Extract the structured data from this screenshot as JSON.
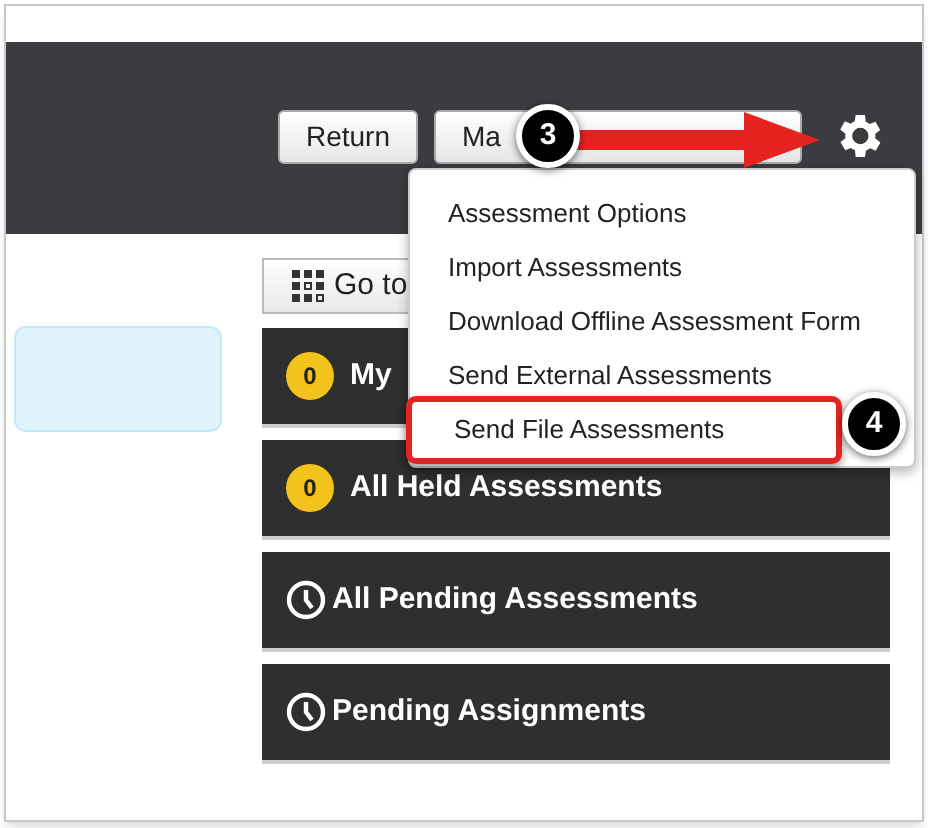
{
  "header": {
    "buttons": [
      {
        "label": "Return"
      },
      {
        "label": "Ma"
      }
    ]
  },
  "callouts": [
    {
      "label": "3"
    },
    {
      "label": "4"
    }
  ],
  "menu": {
    "items": [
      {
        "label": "Assessment Options",
        "selected": false
      },
      {
        "label": "Import Assessments",
        "selected": false
      },
      {
        "label": "Download Offline Assessment Form",
        "selected": false
      },
      {
        "label": "Send External Assessments",
        "selected": false
      },
      {
        "label": "Send File Assessments",
        "selected": true
      }
    ]
  },
  "goto_button": {
    "label": "Go to"
  },
  "tiles": [
    {
      "kind": "count",
      "badge": "0",
      "label": "My"
    },
    {
      "kind": "count",
      "badge": "0",
      "label": "All Held Assessments"
    },
    {
      "kind": "pending",
      "label": "All Pending Assessments"
    },
    {
      "kind": "pending",
      "label": "Pending Assignments"
    }
  ]
}
